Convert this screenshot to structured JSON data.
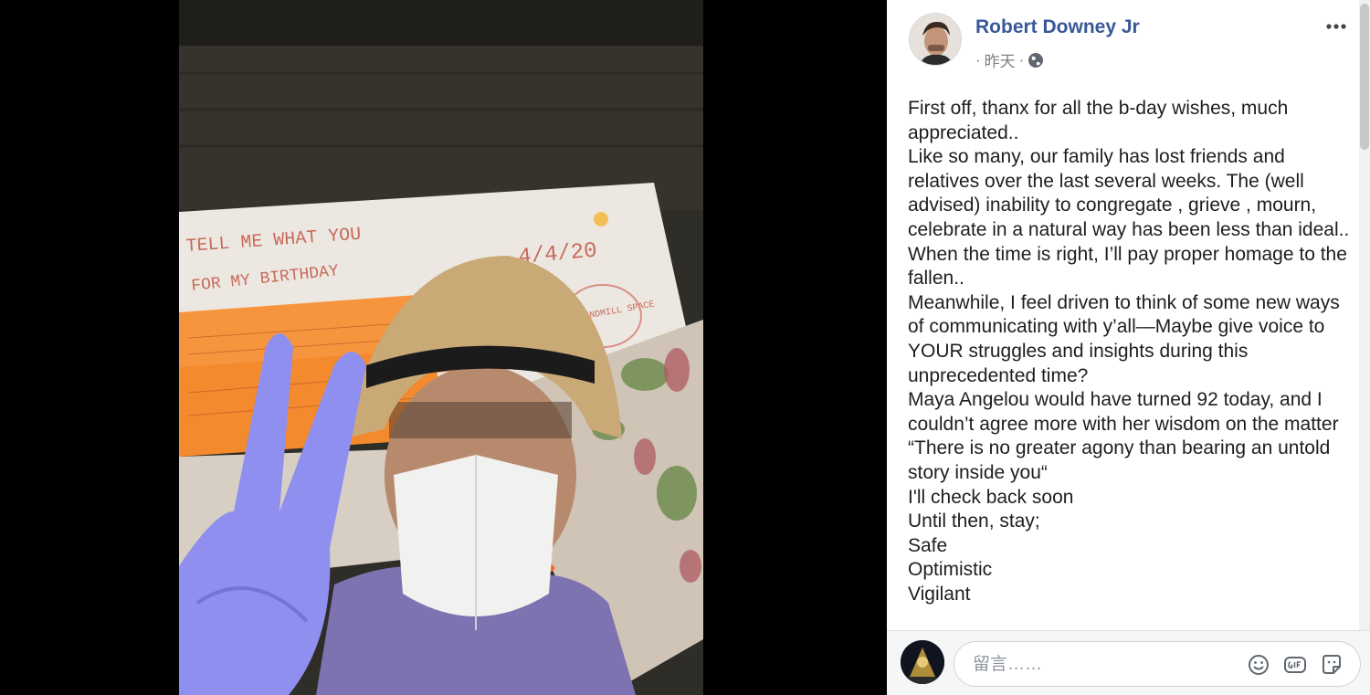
{
  "post": {
    "author": "Robert Downey Jr",
    "time_prefix": "· ",
    "timestamp": "昨天",
    "time_suffix": " ·",
    "privacy_icon": "globe-icon",
    "lines": [
      "First off, thanx for all the b-day wishes, much appreciated..",
      "Like so many, our family has lost friends and relatives over the last several weeks. The (well advised) inability to congregate , grieve , mourn, celebrate in a natural way has been less than ideal..",
      "When the time is right, I’ll pay proper homage to the fallen..",
      "Meanwhile, I feel driven to think of some new ways of communicating with y’all—Maybe give voice to YOUR struggles and insights during this unprecedented time?",
      "Maya Angelou would have turned 92 today, and I couldn’t agree more with her wisdom on the matter “There is no greater agony than bearing an untold story inside you“",
      "I'll check back soon",
      "Until then, stay;",
      "Safe",
      "Optimistic",
      "Vigilant"
    ]
  },
  "photo": {
    "whiteboard_text": [
      "TELL ME WHAT YOU",
      "FOR MY BIRTHDAY",
      "4/4/20",
      "WINDMILL SPACE"
    ]
  },
  "composer": {
    "placeholder": "留言……",
    "icons": [
      "emoji-icon",
      "gif-icon",
      "sticker-icon"
    ]
  },
  "header": {
    "more_icon": "more-options-icon"
  }
}
